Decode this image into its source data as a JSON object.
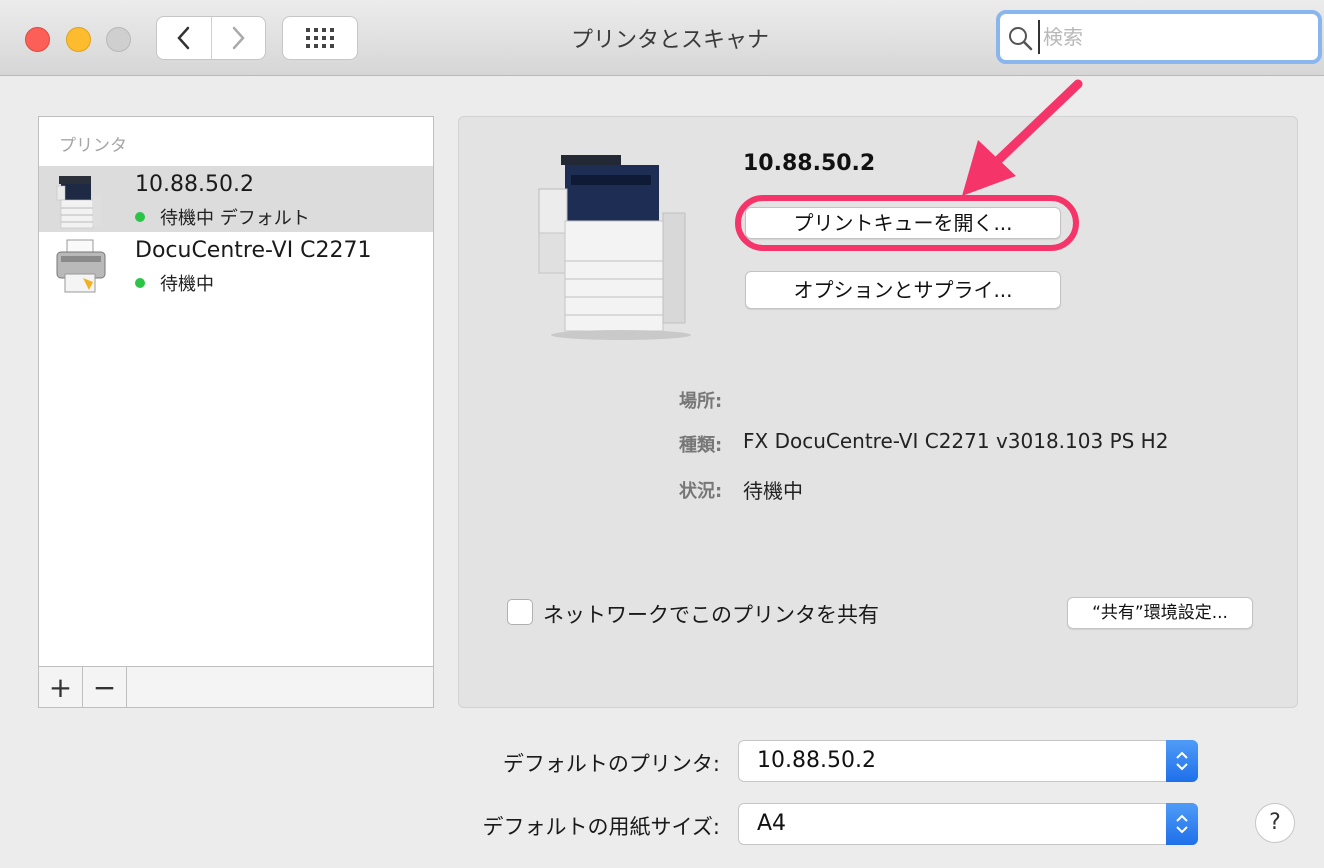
{
  "window": {
    "title": "プリンタとスキャナ",
    "search_placeholder": "検索"
  },
  "sidebar": {
    "header": "プリンタ",
    "printers": [
      {
        "name": "10.88.50.2",
        "status": "待機中 デフォルト",
        "selected": true
      },
      {
        "name": "DocuCentre-VI C2271",
        "status": "待機中",
        "selected": false
      }
    ],
    "add_label": "+",
    "remove_label": "−"
  },
  "detail": {
    "name": "10.88.50.2",
    "open_queue_label": "プリントキューを開く...",
    "options_label": "オプションとサプライ...",
    "location_label": "場所:",
    "location_value": "",
    "kind_label": "種類:",
    "kind_value": "FX DocuCentre-VI C2271 v3018.103 PS H2",
    "status_label": "状況:",
    "status_value": "待機中",
    "share_label": "ネットワークでこのプリンタを共有",
    "share_checked": false,
    "share_prefs_label": "“共有”環境設定..."
  },
  "defaults": {
    "printer_label": "デフォルトのプリンタ:",
    "printer_value": "10.88.50.2",
    "paper_label": "デフォルトの用紙サイズ:",
    "paper_value": "A4"
  },
  "help_label": "?",
  "colors": {
    "highlight": "#f5356a",
    "status_dot": "#2bc446",
    "popup_accent": "#1f6fea"
  }
}
